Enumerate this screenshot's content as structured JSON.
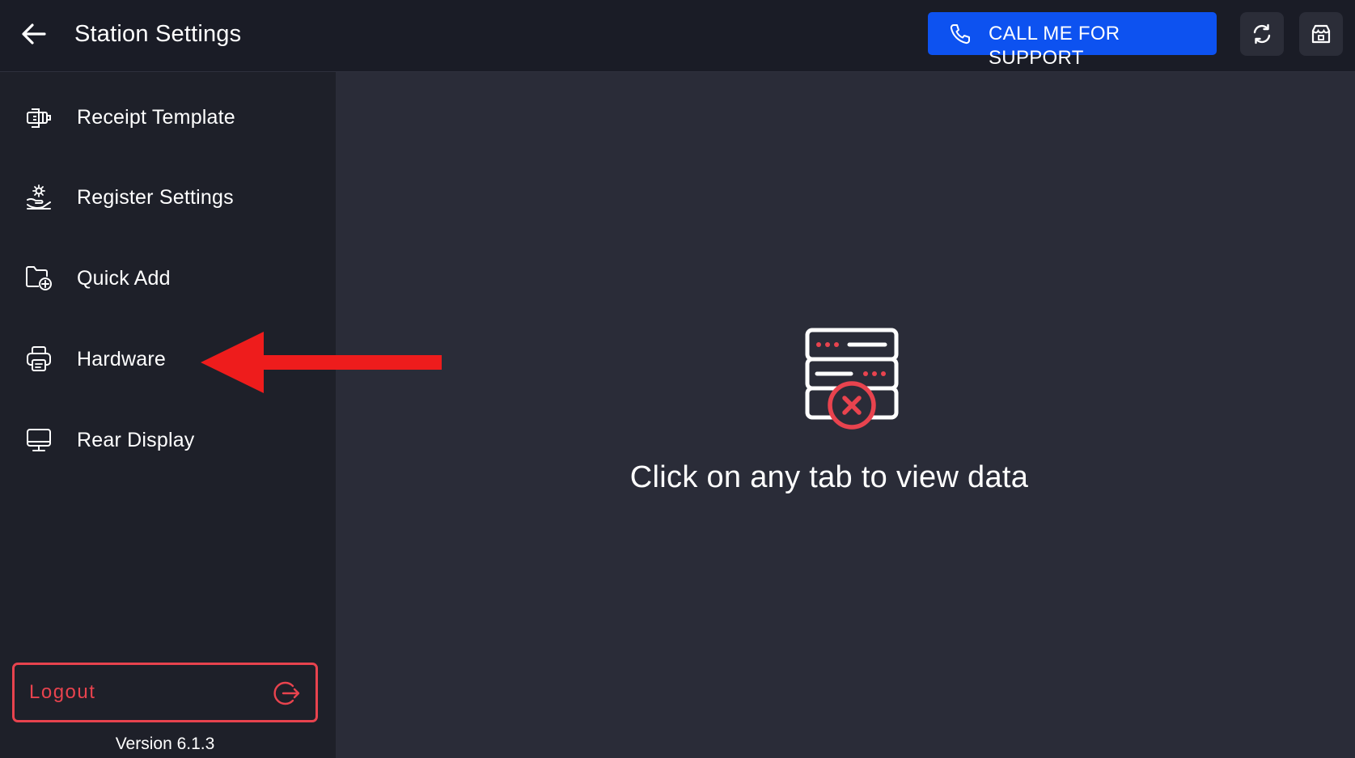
{
  "header": {
    "title": "Station Settings",
    "back_icon": "arrow-left-icon",
    "support_button_label": "CALL ME FOR SUPPORT",
    "support_icon": "phone-icon",
    "refresh_icon": "refresh-icon",
    "store_icon": "store-icon"
  },
  "sidebar": {
    "items": [
      {
        "label": "Receipt Template",
        "icon": "receipt-template-icon"
      },
      {
        "label": "Register Settings",
        "icon": "register-settings-icon"
      },
      {
        "label": "Quick Add",
        "icon": "quick-add-icon"
      },
      {
        "label": "Hardware",
        "icon": "printer-icon"
      },
      {
        "label": "Rear Display",
        "icon": "monitor-icon"
      }
    ],
    "logout_label": "Logout",
    "logout_icon": "logout-icon",
    "version": "Version 6.1.3"
  },
  "main": {
    "empty_message": "Click on any tab to view data",
    "empty_icon": "server-error-icon"
  },
  "colors": {
    "topbar_bg": "#1a1c26",
    "sidebar_bg": "#1e2029",
    "main_bg": "#2a2c38",
    "accent_blue": "#0d52f0",
    "danger_red": "#e8434e",
    "annotation_arrow": "#ee1c1c"
  }
}
